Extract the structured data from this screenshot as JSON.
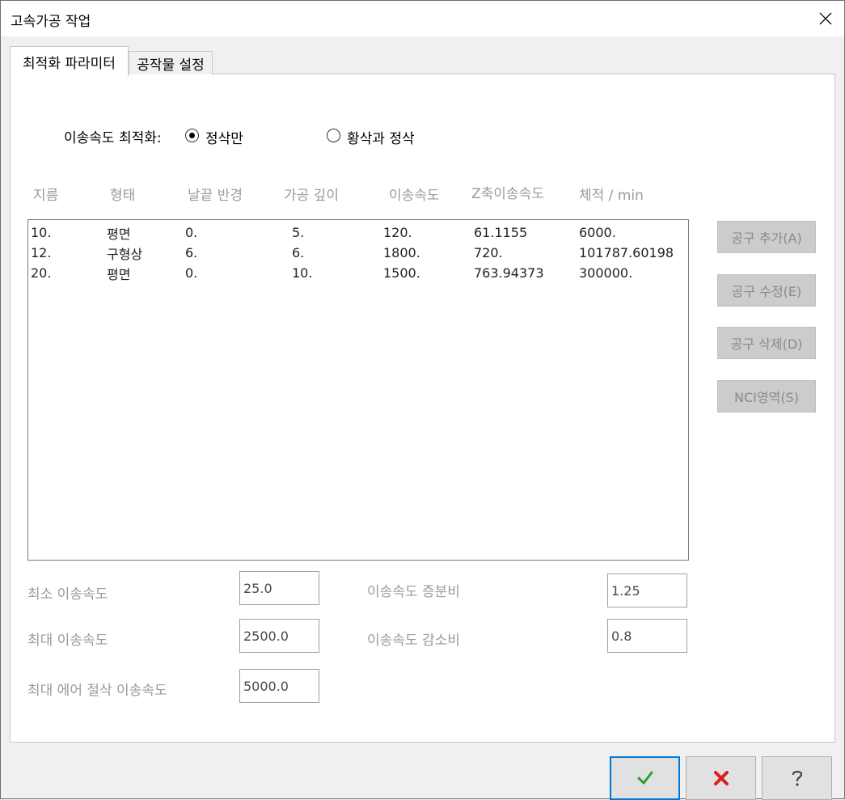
{
  "window": {
    "title": "고속가공 작업"
  },
  "tabs": [
    {
      "label": "최적화 파라미터",
      "active": true
    },
    {
      "label": "공작물 설정",
      "active": false
    }
  ],
  "optimization": {
    "label": "이송속도 최적화:",
    "options": [
      {
        "label": "정삭만",
        "selected": true
      },
      {
        "label": "황삭과 정삭",
        "selected": false
      }
    ]
  },
  "table": {
    "columns": [
      "지름",
      "형태",
      "날끝 반경",
      "가공 깊이",
      "이송속도",
      "Z축이송속도",
      "체적 / min"
    ],
    "rows": [
      [
        "10.",
        "평면",
        "0.",
        "5.",
        "120.",
        "61.1155",
        "6000."
      ],
      [
        "12.",
        "구형상",
        "6.",
        "6.",
        "1800.",
        "720.",
        "101787.60198"
      ],
      [
        "20.",
        "평면",
        "0.",
        "10.",
        "1500.",
        "763.94373",
        "300000."
      ]
    ]
  },
  "side_buttons": {
    "add": "공구 추가(A)",
    "edit": "공구 수정(E)",
    "delete": "공구 삭제(D)",
    "nci": "NCI영역(S)"
  },
  "fields": {
    "min_feed": {
      "label": "최소 이송속도",
      "value": "25.0"
    },
    "max_feed": {
      "label": "최대 이송속도",
      "value": "2500.0"
    },
    "max_air_feed": {
      "label": "최대 에어 절삭 이송속도",
      "value": "5000.0"
    },
    "feed_increase": {
      "label": "이송속도 증분비",
      "value": "1.25"
    },
    "feed_decrease": {
      "label": "이송속도 감소비",
      "value": "0.8"
    }
  },
  "bottom_buttons": [
    {
      "name": "ok",
      "icon": "check-icon",
      "color": "#2e9e2e"
    },
    {
      "name": "cancel",
      "icon": "x-icon",
      "color": "#d92020"
    },
    {
      "name": "help",
      "icon": "question-icon",
      "color": "#555555"
    }
  ],
  "colors": {
    "disabled_text": "#9a9a9a",
    "accent": "#0078d7"
  }
}
